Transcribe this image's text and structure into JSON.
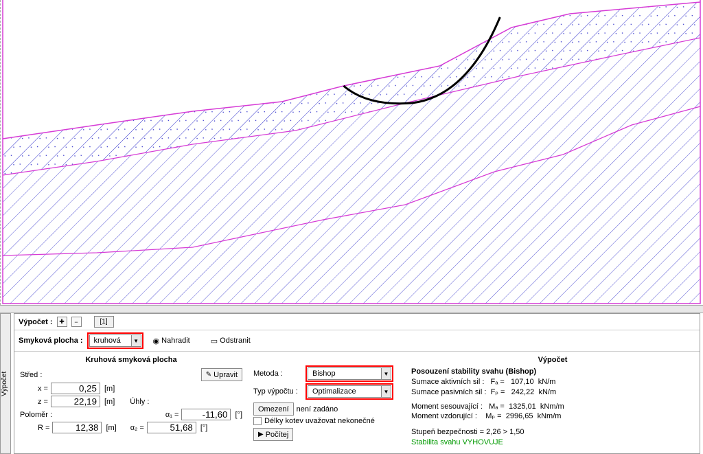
{
  "toolbar": {
    "vypocet_label": "Výpočet :",
    "tab1": "[1]",
    "smykova_label": "Smyková plocha :",
    "smykova_value": "kruhová",
    "nahradit": "Nahradit",
    "odstranit": "Odstranit"
  },
  "left": {
    "title": "Kruhová smyková plocha",
    "upravit": "Upravit",
    "stred": "Střed :",
    "x_label": "x =",
    "x_value": "0,25",
    "x_unit": "[m]",
    "z_label": "z =",
    "z_value": "22,19",
    "z_unit": "[m]",
    "polomer": "Poloměr :",
    "r_label": "R =",
    "r_value": "12,38",
    "r_unit": "[m]",
    "uhly": "Úhly :",
    "a1_label": "α₁ =",
    "a1_value": "-11,60",
    "a1_unit": "[°]",
    "a2_label": "α₂ =",
    "a2_value": "51,68",
    "a2_unit": "[°]"
  },
  "mid": {
    "metoda_label": "Metoda :",
    "metoda_value": "Bishop",
    "typ_label": "Typ výpočtu :",
    "typ_value": "Optimalizace",
    "omezeni": "Omezení",
    "omezeni_state": "není zadáno",
    "kotvy": "Délky kotev uvažovat nekonečné",
    "pocitej": "Počítej"
  },
  "right": {
    "title": "Výpočet",
    "heading": "Posouzení stability svahu (Bishop)",
    "line1_lbl": "Sumace aktivních sil :",
    "line1_sym": "Fₐ =",
    "line1_val": "107,10",
    "line1_unit": "kN/m",
    "line2_lbl": "Sumace pasivních sil :",
    "line2_sym": "Fₚ =",
    "line2_val": "242,22",
    "line2_unit": "kN/m",
    "line3_lbl": "Moment sesouvající :",
    "line3_sym": "Mₐ =",
    "line3_val": "1325,01",
    "line3_unit": "kNm/m",
    "line4_lbl": "Moment vzdorující :",
    "line4_sym": "Mₚ =",
    "line4_val": "2996,65",
    "line4_unit": "kNm/m",
    "sof": "Stupeň bezpečnosti = 2,26 > 1,50",
    "verdict": "Stabilita svahu VYHOVUJE"
  },
  "vtab": "Výpočet"
}
